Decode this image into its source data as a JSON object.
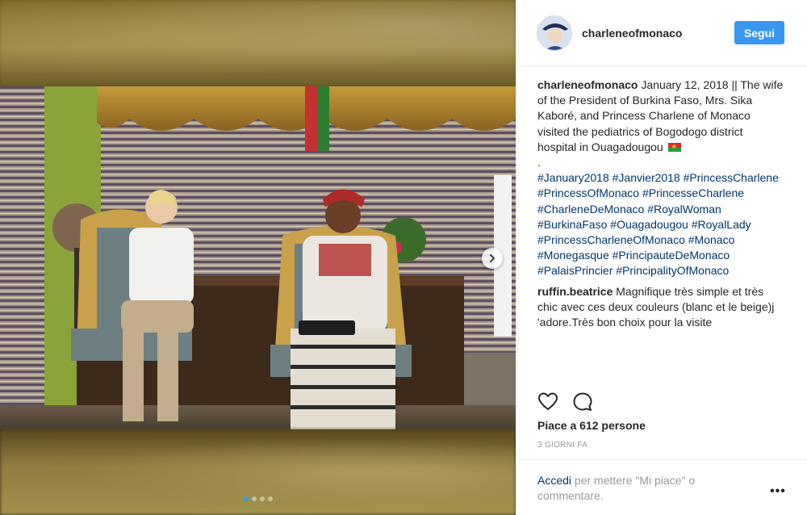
{
  "post": {
    "username": "charleneofmonaco",
    "follow_label": "Segui",
    "caption": {
      "username": "charleneofmonaco",
      "text": "January 12, 2018 || The wife of the President of Burkina Faso, Mrs. Sika Kaboré, and Princess Charlene of Monaco visited the pediatrics of Bogodogo district hospital in Ouagadougou",
      "flag_icon": "burkina-faso-flag-icon",
      "separator": ".",
      "hashtags": [
        "#January2018",
        "#Janvier2018",
        "#PrincessCharlene",
        "#PrincessOfMonaco",
        "#PrincesseCharlene",
        "#CharleneDeMonaco",
        "#RoyalWoman",
        "#BurkinaFaso",
        "#Ouagadougou",
        "#RoyalLady",
        "#PrincessCharleneOfMonaco",
        "#Monaco",
        "#Monegasque",
        "#PrincipauteDeMonaco",
        "#PalaisPrincier",
        "#PrincipalityOfMonaco"
      ]
    },
    "comments": [
      {
        "username": "ruffin.beatrice",
        "text": "Magnifique très simple et très chic avec ces deux couleurs (blanc et le beige)j 'adore.Très bon choix pour la visite"
      }
    ],
    "likes_label": "Piace a 612 persone",
    "time_label": "3 GIORNI FA",
    "login_link": "Accedi",
    "login_rest": "per mettere \"Mi piace\" o commentare.",
    "more_label": "•••"
  },
  "carousel": {
    "total": 4,
    "active_index": 0
  },
  "colors": {
    "accent": "#3897f0",
    "link": "#003569",
    "muted": "#999999",
    "text": "#262626"
  }
}
